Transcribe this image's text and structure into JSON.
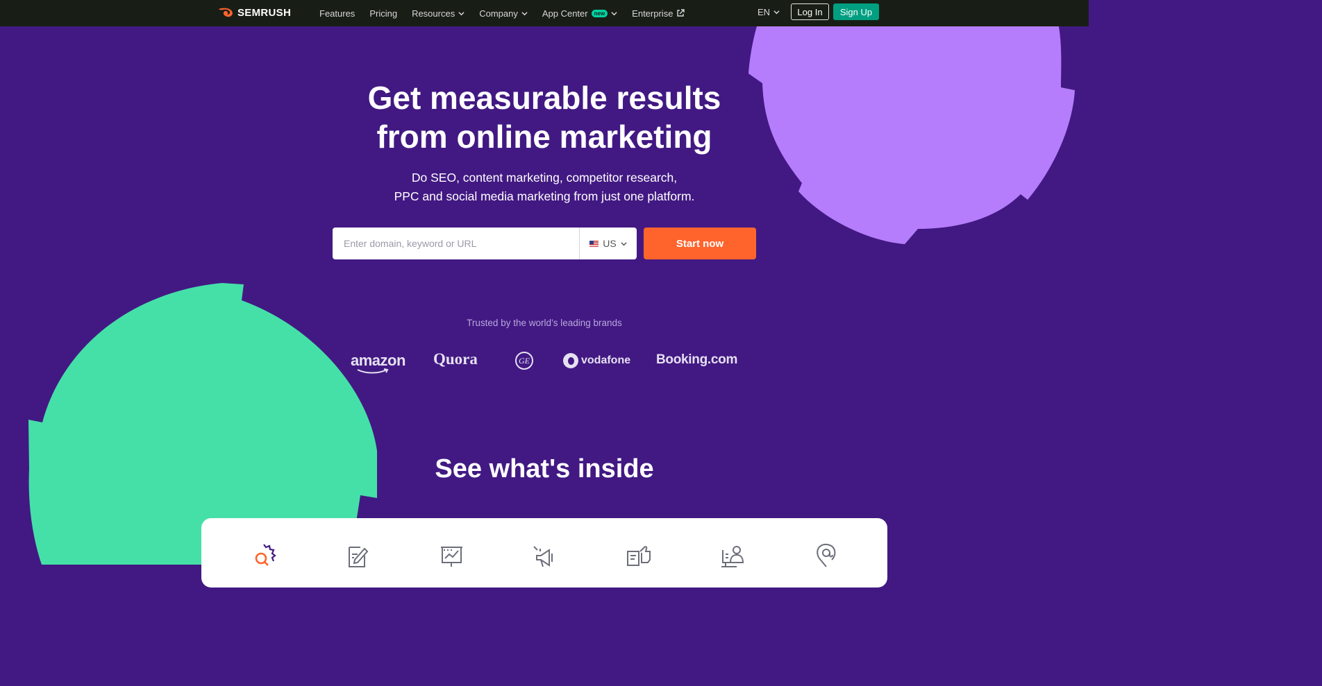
{
  "header": {
    "brand": "SEMRUSH",
    "nav": [
      {
        "label": "Features",
        "dropdown": false
      },
      {
        "label": "Pricing",
        "dropdown": false
      },
      {
        "label": "Resources",
        "dropdown": true
      },
      {
        "label": "Company",
        "dropdown": true
      },
      {
        "label": "App Center",
        "dropdown": true,
        "badge": "new"
      },
      {
        "label": "Enterprise",
        "external": true
      }
    ],
    "language": "EN",
    "login_label": "Log In",
    "signup_label": "Sign Up"
  },
  "hero": {
    "title_line1": "Get measurable results",
    "title_line2": "from online marketing",
    "subtitle_line1": "Do SEO, content marketing, competitor research,",
    "subtitle_line2": "PPC and social media marketing from just one platform.",
    "search_placeholder": "Enter domain, keyword or URL",
    "database": "US",
    "cta_label": "Start now"
  },
  "trusted": {
    "heading": "Trusted by the world’s leading brands",
    "brands": [
      "amazon",
      "Quora",
      "GE",
      "vodafone",
      "Booking.com"
    ]
  },
  "inside": {
    "title": "See what's inside",
    "tool_icons": [
      "seo-icon",
      "content-marketing-icon",
      "market-research-icon",
      "advertising-icon",
      "social-media-icon",
      "agency-solutions-icon",
      "local-icon"
    ]
  },
  "colors": {
    "background": "#421983",
    "topbar": "#181e15",
    "accent_orange": "#ff642d",
    "signup_green": "#009f81",
    "blob_purple": "#b57dfb",
    "blob_green": "#45e0a8"
  }
}
